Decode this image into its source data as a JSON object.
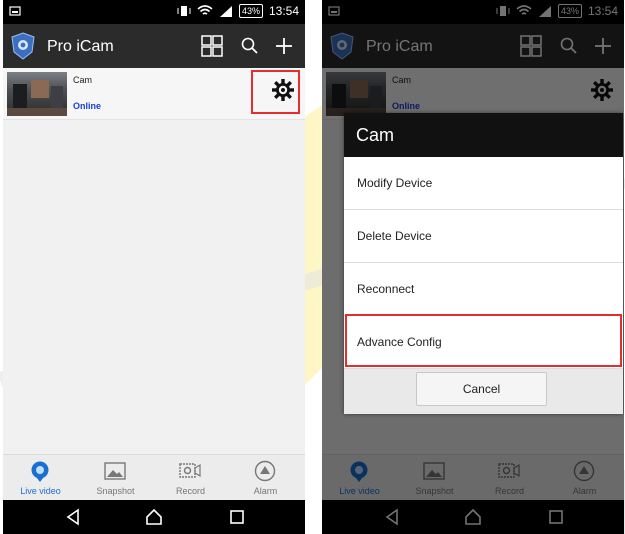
{
  "status_bar": {
    "battery": "43%",
    "time": "13:54"
  },
  "app": {
    "title": "Pro iCam"
  },
  "device": {
    "name": "Cam",
    "id": "",
    "status": "Online"
  },
  "tabs": [
    {
      "label": "Live video",
      "active": true
    },
    {
      "label": "Snapshot",
      "active": false
    },
    {
      "label": "Record",
      "active": false
    },
    {
      "label": "Alarm",
      "active": false
    }
  ],
  "dialog": {
    "title": "Cam",
    "items": [
      "Modify Device",
      "Delete Device",
      "Reconnect",
      "Advance Config"
    ],
    "cancel_label": "Cancel"
  },
  "colors": {
    "highlight": "#e52d2d",
    "status_online": "#1a3dd6",
    "tab_active": "#1a6fd0"
  }
}
